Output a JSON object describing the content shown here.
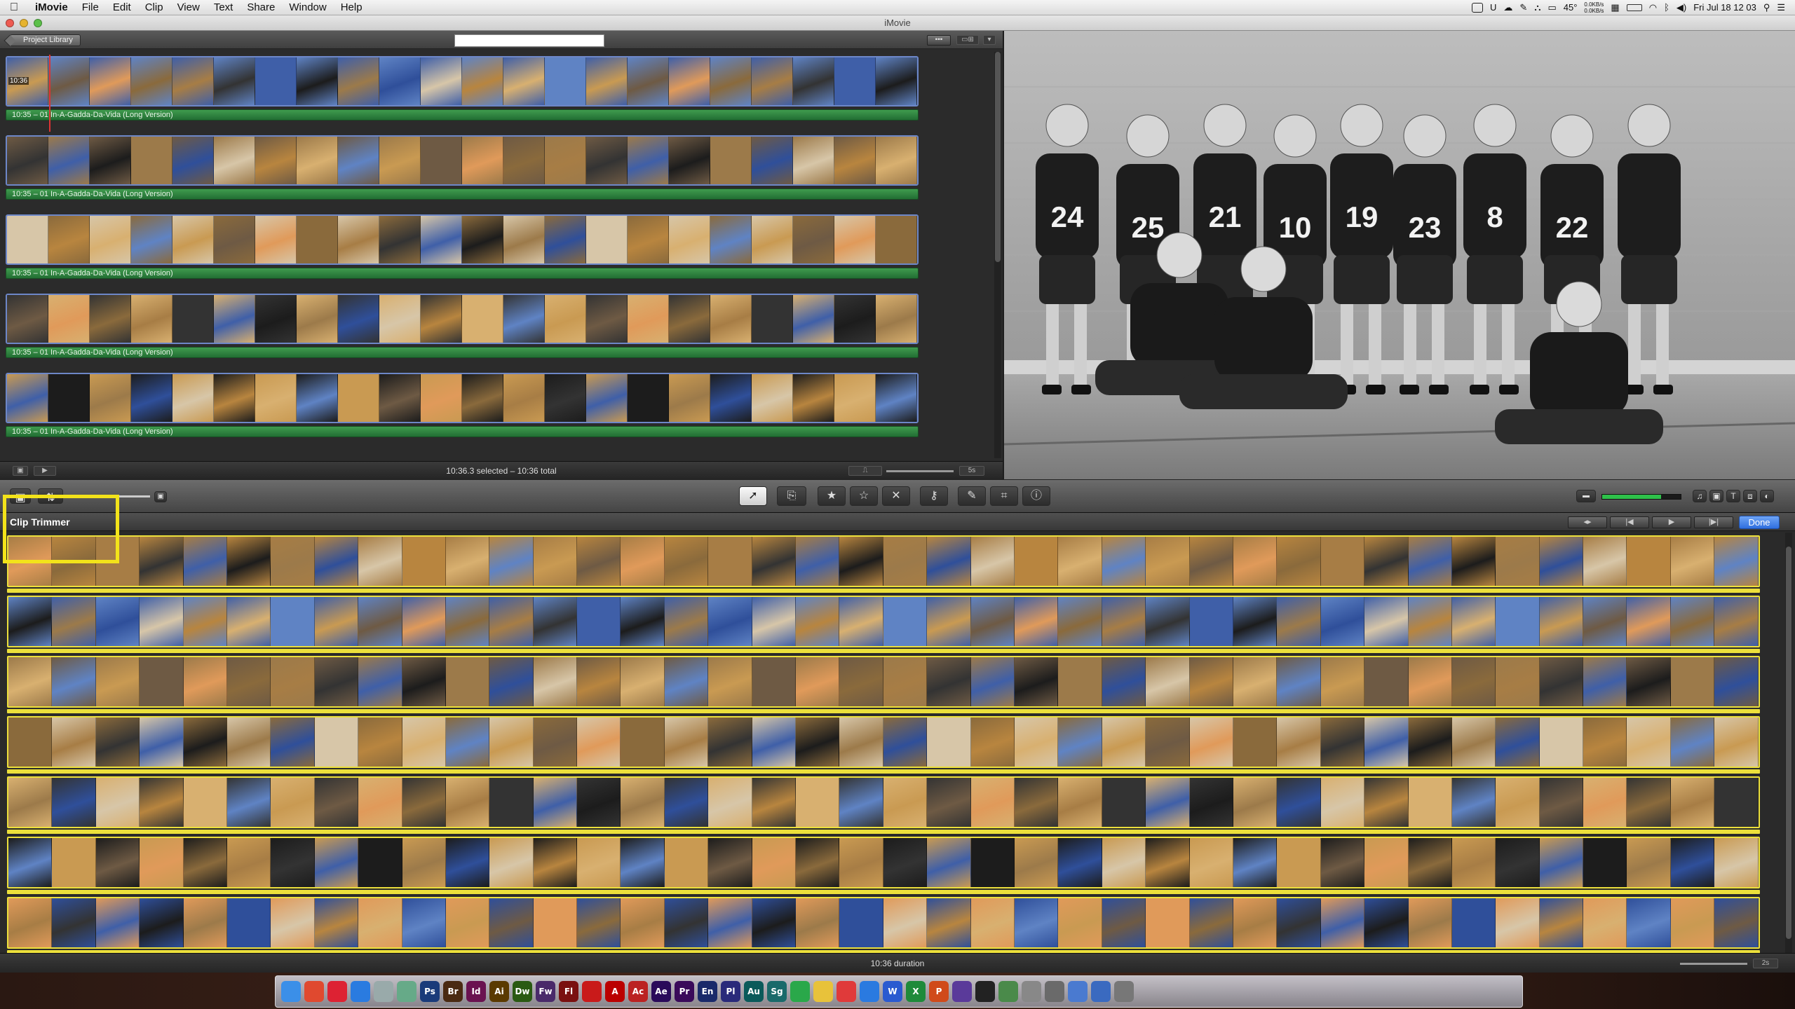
{
  "menubar": {
    "apple": "",
    "app_name": "iMovie",
    "items": [
      "File",
      "Edit",
      "Clip",
      "View",
      "Text",
      "Share",
      "Window",
      "Help"
    ],
    "status": {
      "temperature": "45°",
      "network_up": "0.0KB/s",
      "network_down": "0.0KB/s",
      "clock": "Fri Jul 18  12 03"
    }
  },
  "window": {
    "title": "iMovie"
  },
  "project": {
    "library_button": "Project Library",
    "project_name_value": "",
    "playhead_time": "10:36",
    "rows": [
      {
        "music": "10:35 – 01 In-A-Gadda-Da-Vida (Long Version)"
      },
      {
        "music": "10:35 – 01 In-A-Gadda-Da-Vida (Long Version)"
      },
      {
        "music": "10:35 – 01 In-A-Gadda-Da-Vida (Long Version)"
      },
      {
        "music": "10:35 – 01 In-A-Gadda-Da-Vida (Long Version)"
      },
      {
        "music": "10:35 – 01 In-A-Gadda-Da-Vida (Long Version)"
      }
    ],
    "status": "10:36.3 selected – 10:36 total",
    "thumb_duration": "5s"
  },
  "viewer": {
    "photo": "black-and-white-basketball-team-photo",
    "jersey_numbers": [
      "24",
      "25",
      "21",
      "10",
      "19",
      "23",
      "8",
      "22"
    ]
  },
  "toolbar": {
    "tools": [
      "arrow-select-tool",
      "add-selection-tool",
      "favorite-star",
      "unmark-star",
      "reject-x",
      "keyword-tool",
      "color-dropper",
      "crop-tool",
      "inspector-info"
    ],
    "browser_buttons": [
      "music-browser",
      "photo-browser",
      "title-browser",
      "transition-browser",
      "maps-browser"
    ]
  },
  "event": {
    "header": "Clip Trimmer",
    "done_button": "Done",
    "status": "10:36 duration",
    "thumb_duration": "2s"
  },
  "dock": {
    "items": [
      "Finder",
      "Chrome",
      "Mail",
      "Safari",
      "Preview",
      "Photos",
      "Ps",
      "Br",
      "Id",
      "Ai",
      "Dw",
      "Fw",
      "Fl",
      "Acrobat",
      "A",
      "Ac",
      "Ae",
      "Pr",
      "En",
      "Pl",
      "Au",
      "Sg",
      "Messages",
      "Notes",
      "Calendar",
      "iTunes",
      "W",
      "X",
      "P",
      "iMovie",
      "Terminal",
      "Activity",
      "Mac",
      "Rest",
      "Folder",
      "Downloads",
      "Trash"
    ]
  },
  "colors": {
    "highlight": "#f3e31a",
    "music_track": "#2f8a42",
    "clip_border": "#6d87c8",
    "done": "#3b7de8"
  }
}
